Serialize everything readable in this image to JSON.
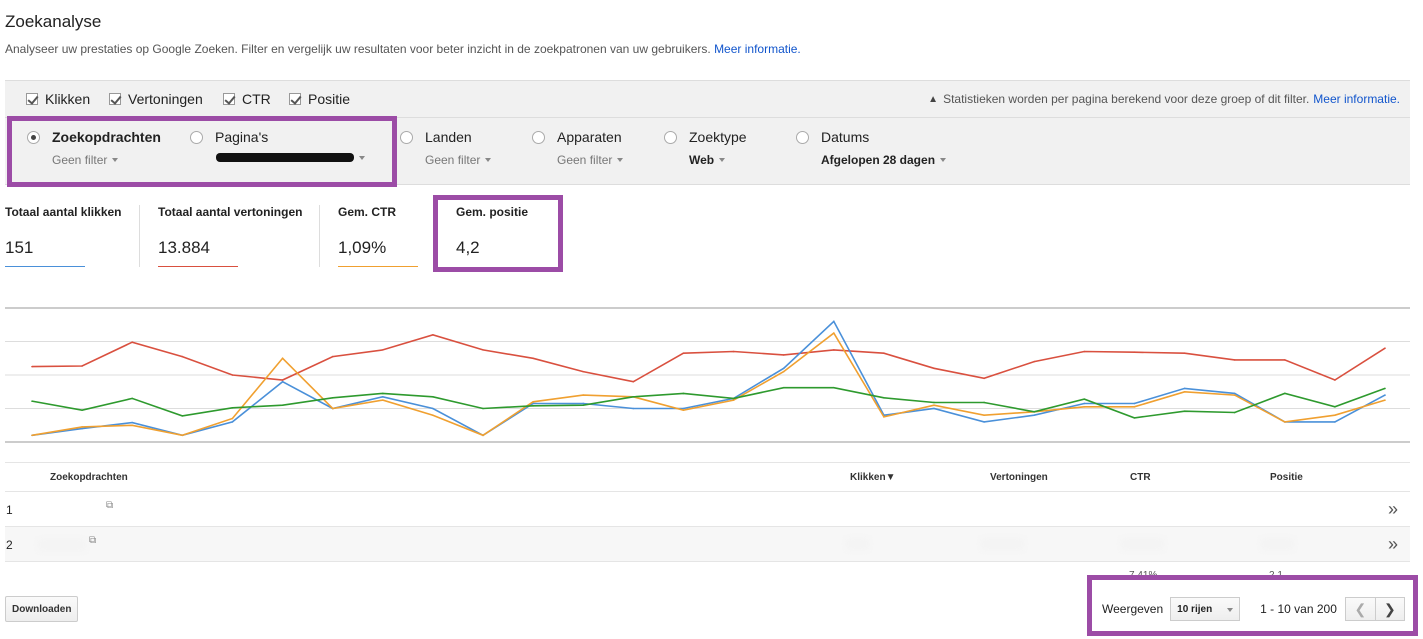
{
  "page": {
    "title": "Zoekanalyse",
    "description": "Analyseer uw prestaties op Google Zoeken. Filter en vergelijk uw resultaten voor beter inzicht in de zoekpatronen van uw gebruikers.",
    "more_info": "Meer informatie."
  },
  "metrics": {
    "clicks": "Klikken",
    "impressions": "Vertoningen",
    "ctr": "CTR",
    "position": "Positie",
    "stats_note": "Statistieken worden per pagina berekend voor deze groep of dit filter.",
    "stats_link": "Meer informatie."
  },
  "dimensions": {
    "queries": {
      "label": "Zoekopdrachten",
      "filter": "Geen filter"
    },
    "pages": {
      "label": "Pagina's",
      "filter": ""
    },
    "countries": {
      "label": "Landen",
      "filter": "Geen filter"
    },
    "devices": {
      "label": "Apparaten",
      "filter": "Geen filter"
    },
    "search_type": {
      "label": "Zoektype",
      "filter": "Web"
    },
    "dates": {
      "label": "Datums",
      "filter": "Afgelopen 28 dagen"
    }
  },
  "summary": {
    "clicks": {
      "label": "Totaal aantal klikken",
      "value": "151",
      "color": "#4a90d9"
    },
    "impressions": {
      "label": "Totaal aantal vertoningen",
      "value": "13.884",
      "color": "#d9503f"
    },
    "ctr": {
      "label": "Gem. CTR",
      "value": "1,09%",
      "color": "#f0a030"
    },
    "position": {
      "label": "Gem. positie",
      "value": "4,2"
    }
  },
  "chart_data": {
    "type": "line",
    "x": [
      1,
      2,
      3,
      4,
      5,
      6,
      7,
      8,
      9,
      10,
      11,
      12,
      13,
      14,
      15,
      16,
      17,
      18,
      19,
      20,
      21,
      22,
      23,
      24,
      25,
      26,
      27,
      28
    ],
    "ylim": [
      0,
      4
    ],
    "grid": true,
    "series": [
      {
        "color": "#d9503f",
        "values": [
          2.25,
          2.27,
          2.98,
          2.55,
          2.0,
          1.85,
          2.55,
          2.75,
          3.2,
          2.75,
          2.5,
          2.1,
          1.8,
          2.65,
          2.7,
          2.6,
          2.75,
          2.65,
          2.2,
          1.9,
          2.4,
          2.7,
          2.68,
          2.65,
          2.45,
          2.45,
          1.85,
          2.8
        ]
      },
      {
        "color": "#4a90d9",
        "values": [
          0.2,
          0.4,
          0.58,
          0.2,
          0.6,
          1.8,
          1.0,
          1.35,
          1.0,
          0.2,
          1.15,
          1.15,
          1.0,
          1.0,
          1.3,
          2.2,
          3.6,
          0.8,
          1.0,
          0.6,
          0.8,
          1.15,
          1.15,
          1.6,
          1.45,
          0.6,
          0.6,
          1.4
        ]
      },
      {
        "color": "#f0a030",
        "values": [
          0.2,
          0.45,
          0.5,
          0.2,
          0.7,
          2.5,
          1.0,
          1.25,
          0.8,
          0.2,
          1.2,
          1.4,
          1.35,
          0.95,
          1.25,
          2.1,
          3.25,
          0.75,
          1.1,
          0.8,
          0.9,
          1.05,
          1.05,
          1.5,
          1.4,
          0.6,
          0.8,
          1.25
        ]
      },
      {
        "color": "#2e9a2e",
        "values": [
          1.22,
          0.95,
          1.3,
          0.78,
          1.02,
          1.1,
          1.32,
          1.45,
          1.35,
          1.0,
          1.08,
          1.1,
          1.35,
          1.45,
          1.3,
          1.62,
          1.62,
          1.32,
          1.18,
          1.18,
          0.9,
          1.28,
          0.72,
          0.92,
          0.88,
          1.45,
          1.05,
          1.6
        ]
      }
    ]
  },
  "table": {
    "headers": {
      "query": "Zoekopdrachten",
      "clicks": "Klikken▼",
      "impressions": "Vertoningen",
      "ctr": "CTR",
      "position": "Positie"
    },
    "rows": [
      {
        "num": "1",
        "expand": "»"
      },
      {
        "num": "2",
        "expand": "»"
      }
    ],
    "row3_ctr_fragment": "7,41%",
    "row3_pos_fragment": "2,1"
  },
  "footer": {
    "download": "Downloaden",
    "show": "Weergeven",
    "rows_option": "10 rijen",
    "range": "1 - 10 van 200"
  }
}
